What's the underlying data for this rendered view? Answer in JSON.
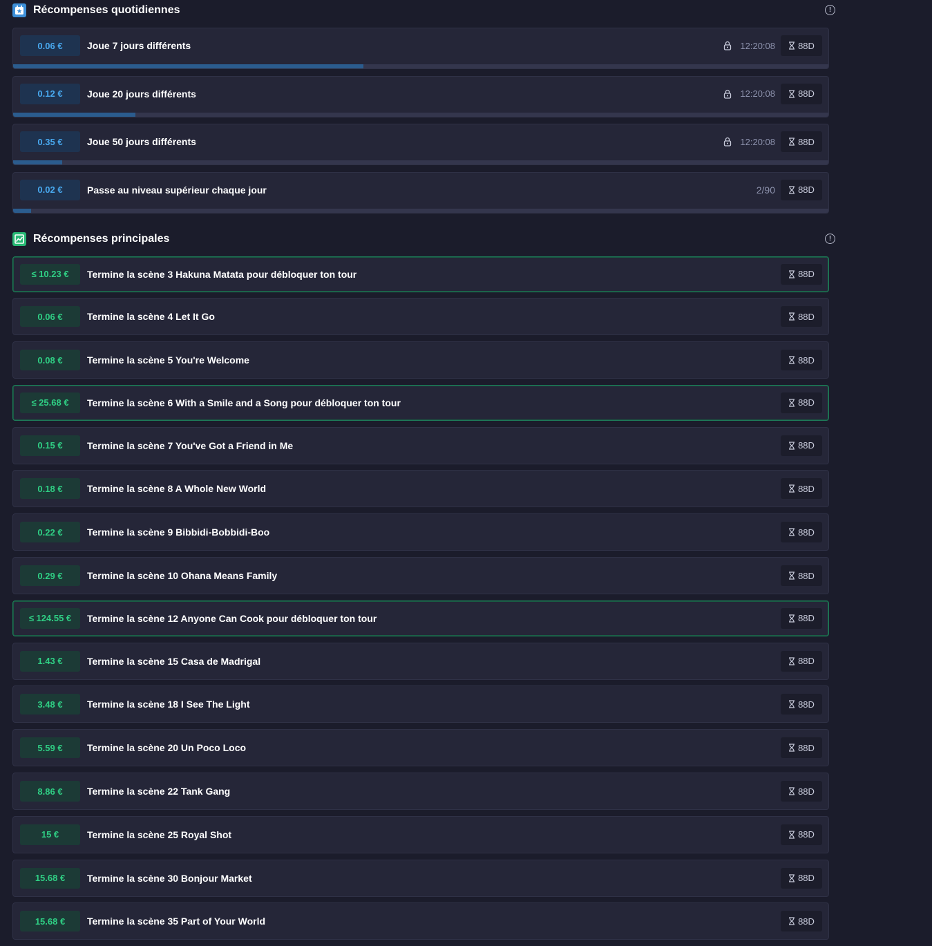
{
  "daily": {
    "title": "Récompenses quotidiennes",
    "items": [
      {
        "reward": "0.06 €",
        "label": "Joue 7 jours différents",
        "timer": "12:20:08",
        "days": "88D",
        "progress": 0.43
      },
      {
        "reward": "0.12 €",
        "label": "Joue 20 jours différents",
        "timer": "12:20:08",
        "days": "88D",
        "progress": 0.15
      },
      {
        "reward": "0.35 €",
        "label": "Joue 50 jours différents",
        "timer": "12:20:08",
        "days": "88D",
        "progress": 0.06
      },
      {
        "reward": "0.02 €",
        "label": "Passe au niveau supérieur chaque jour",
        "count": "2/90",
        "days": "88D",
        "progress": 0.022
      }
    ]
  },
  "main": {
    "title": "Récompenses principales",
    "items": [
      {
        "reward": "≤ 10.23 €",
        "label": "Termine la scène 3 Hakuna Matata pour débloquer ton tour",
        "days": "88D",
        "featured": true
      },
      {
        "reward": "0.06 €",
        "label": "Termine la scène 4 Let It Go",
        "days": "88D"
      },
      {
        "reward": "0.08 €",
        "label": "Termine la scène 5 You're Welcome",
        "days": "88D"
      },
      {
        "reward": "≤ 25.68 €",
        "label": "Termine la scène 6 With a Smile and a Song pour débloquer ton tour",
        "days": "88D",
        "featured": true
      },
      {
        "reward": "0.15 €",
        "label": "Termine la scène 7 You've Got a Friend in Me",
        "days": "88D"
      },
      {
        "reward": "0.18 €",
        "label": "Termine la scène 8 A Whole New World",
        "days": "88D"
      },
      {
        "reward": "0.22 €",
        "label": "Termine la scène 9 Bibbidi-Bobbidi-Boo",
        "days": "88D"
      },
      {
        "reward": "0.29 €",
        "label": "Termine la scène 10 Ohana Means Family",
        "days": "88D"
      },
      {
        "reward": "≤ 124.55 €",
        "label": "Termine la scène 12 Anyone Can Cook pour débloquer ton tour",
        "days": "88D",
        "featured": true
      },
      {
        "reward": "1.43 €",
        "label": "Termine la scène 15 Casa de Madrigal",
        "days": "88D"
      },
      {
        "reward": "3.48 €",
        "label": "Termine la scène 18 I See The Light",
        "days": "88D"
      },
      {
        "reward": "5.59 €",
        "label": "Termine la scène 20 Un Poco Loco",
        "days": "88D"
      },
      {
        "reward": "8.86 €",
        "label": "Termine la scène 22 Tank Gang",
        "days": "88D"
      },
      {
        "reward": "15 €",
        "label": "Termine la scène 25 Royal Shot",
        "days": "88D"
      },
      {
        "reward": "15.68 €",
        "label": "Termine la scène 30 Bonjour Market",
        "days": "88D"
      },
      {
        "reward": "15.68 €",
        "label": "Termine la scène 35 Part of Your World",
        "days": "88D"
      }
    ]
  },
  "colors": {
    "background": "#1b1c2b",
    "card": "#252638",
    "daily_reward_text": "#48a8ee",
    "main_reward_text": "#2fcf84",
    "featured_border": "#1e7a58",
    "progress_fill": "#2b5c8e"
  },
  "icons": {
    "daily": "calendar-star-icon",
    "main": "image-chart-icon",
    "info": "info-icon",
    "lock": "lock-icon",
    "timer": "hourglass-icon"
  }
}
